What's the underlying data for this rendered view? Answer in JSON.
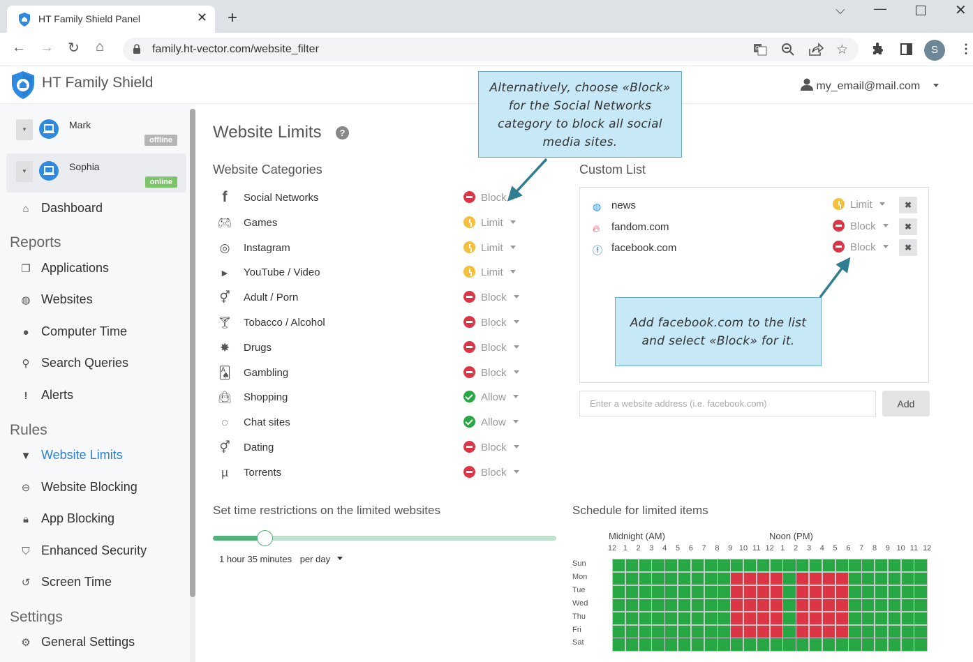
{
  "browser": {
    "tab_title": "HT Family Shield Panel",
    "url": "family.ht-vector.com/website_filter",
    "profile_initial": "S",
    "icons": [
      "back-icon",
      "forward-icon",
      "reload-icon",
      "home-icon",
      "lock-icon",
      "translate-icon",
      "zoom-out-icon",
      "share-icon",
      "star-icon",
      "extensions-icon",
      "sidepanel-icon",
      "menu-icon"
    ]
  },
  "header": {
    "brand": "HT Family Shield",
    "user_email": "my_email@mail.com"
  },
  "sidebar": {
    "devices": [
      {
        "name": "Mark",
        "status": "offline",
        "status_color": "#b5b5b5"
      },
      {
        "name": "Sophia",
        "status": "online",
        "status_color": "#7dc36b"
      }
    ],
    "dashboard": "Dashboard",
    "sections": [
      {
        "title": "Reports",
        "items": [
          {
            "label": "Applications",
            "icon": "window-icon"
          },
          {
            "label": "Websites",
            "icon": "globe-icon"
          },
          {
            "label": "Computer Time",
            "icon": "clock-icon"
          },
          {
            "label": "Search Queries",
            "icon": "search-icon"
          },
          {
            "label": "Alerts",
            "icon": "exclamation-icon"
          }
        ]
      },
      {
        "title": "Rules",
        "items": [
          {
            "label": "Website Limits",
            "icon": "filter-icon",
            "active": true
          },
          {
            "label": "Website Blocking",
            "icon": "minus-circle-icon"
          },
          {
            "label": "App Blocking",
            "icon": "lock-icon"
          },
          {
            "label": "Enhanced Security",
            "icon": "shield-icon"
          },
          {
            "label": "Screen Time",
            "icon": "history-icon"
          }
        ]
      },
      {
        "title": "Settings",
        "items": [
          {
            "label": "General Settings",
            "icon": "gear-icon"
          }
        ]
      }
    ]
  },
  "main": {
    "title": "Website Limits",
    "categories_title": "Website Categories",
    "categories": [
      {
        "name": "Social Networks",
        "icon": "facebook-icon",
        "status": "Block"
      },
      {
        "name": "Games",
        "icon": "gamepad-icon",
        "status": "Limit"
      },
      {
        "name": "Instagram",
        "icon": "instagram-icon",
        "status": "Limit"
      },
      {
        "name": "YouTube / Video",
        "icon": "youtube-icon",
        "status": "Limit"
      },
      {
        "name": "Adult / Porn",
        "icon": "gender-icon",
        "status": "Block"
      },
      {
        "name": "Tobacco / Alcohol",
        "icon": "cocktail-icon",
        "status": "Block"
      },
      {
        "name": "Drugs",
        "icon": "cannabis-icon",
        "status": "Block"
      },
      {
        "name": "Gambling",
        "icon": "cards-icon",
        "status": "Block"
      },
      {
        "name": "Shopping",
        "icon": "shopping-bag-icon",
        "status": "Allow"
      },
      {
        "name": "Chat sites",
        "icon": "messenger-icon",
        "status": "Allow"
      },
      {
        "name": "Dating",
        "icon": "gender-icon",
        "status": "Block"
      },
      {
        "name": "Torrents",
        "icon": "utorrent-icon",
        "status": "Block"
      }
    ],
    "status_colors": {
      "Block": "#dc3545",
      "Limit": "#f4bf3a",
      "Allow": "#28a745"
    },
    "custom_list_title": "Custom List",
    "custom_list": [
      {
        "domain": "news",
        "icon": "globe-icon",
        "status": "Limit"
      },
      {
        "domain": "fandom.com",
        "icon": "fandom-icon",
        "status": "Block"
      },
      {
        "domain": "facebook.com",
        "icon": "facebook-icon",
        "status": "Block"
      }
    ],
    "site_input_placeholder": "Enter a website address (i.e. facebook.com)",
    "add_button": "Add",
    "time_title": "Set time restrictions on the limited websites",
    "time_value": "1 hour 35 minutes",
    "time_period": "per day",
    "slider_fraction": 0.15,
    "schedule_title": "Schedule for limited items",
    "schedule_am_label": "Midnight (AM)",
    "schedule_pm_label": "Noon (PM)",
    "schedule_hour_labels": [
      "12",
      "1",
      "2",
      "3",
      "4",
      "5",
      "6",
      "7",
      "8",
      "9",
      "10",
      "11",
      "12",
      "1",
      "2",
      "3",
      "4",
      "5",
      "6",
      "7",
      "8",
      "9",
      "10",
      "11",
      "12"
    ],
    "schedule_days": [
      "Sun",
      "Mon",
      "Tue",
      "Wed",
      "Thu",
      "Fri",
      "Sat"
    ],
    "schedule_colors": {
      "allowed": "#28a745",
      "blocked": "#dc3545"
    },
    "schedule_blocked_hours": {
      "Sun": [],
      "Mon": [
        9,
        10,
        11,
        12,
        14,
        15,
        16,
        17
      ],
      "Tue": [
        9,
        10,
        11,
        12,
        14,
        15,
        16,
        17
      ],
      "Wed": [
        9,
        10,
        11,
        12,
        14,
        15,
        16,
        17
      ],
      "Thu": [
        9,
        10,
        11,
        12,
        14,
        15,
        16,
        17
      ],
      "Fri": [
        9,
        10,
        11,
        12,
        14,
        15,
        16,
        17
      ],
      "Sat": []
    }
  },
  "callouts": {
    "top": "Alternatively, choose «Block» for the Social Networks category to block all social media sites.",
    "bottom": "Add facebook.com to the list and select «Block» for it."
  }
}
